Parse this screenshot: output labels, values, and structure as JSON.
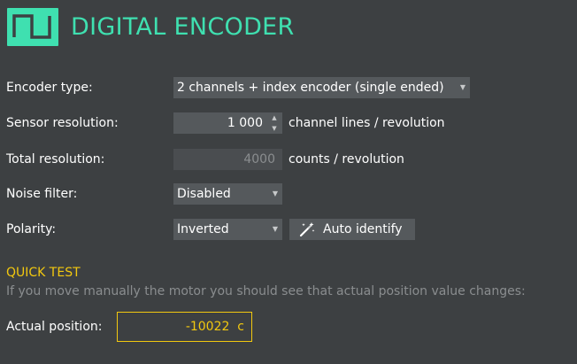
{
  "header": {
    "title": "DIGITAL ENCODER",
    "accent_color": "#3fe0b0",
    "logo_icon": "square-wave-icon"
  },
  "form": {
    "encoder_type": {
      "label": "Encoder type:",
      "selected": "2 channels + index encoder (single ended)"
    },
    "sensor_resolution": {
      "label": "Sensor resolution:",
      "value": "1 000",
      "unit": "channel lines / revolution"
    },
    "total_resolution": {
      "label": "Total resolution:",
      "value": "4000",
      "unit": "counts / revolution"
    },
    "noise_filter": {
      "label": "Noise filter:",
      "selected": "Disabled"
    },
    "polarity": {
      "label": "Polarity:",
      "selected": "Inverted",
      "auto_identify_label": "Auto identify",
      "auto_identify_icon": "magic-wand-icon"
    }
  },
  "quick_test": {
    "title": "QUICK TEST",
    "hint": "If you move manually the motor you should see that actual position value changes:",
    "actual_position_label": "Actual position:",
    "actual_position_value": "-10022  c",
    "highlight_color": "#f2c80f"
  }
}
